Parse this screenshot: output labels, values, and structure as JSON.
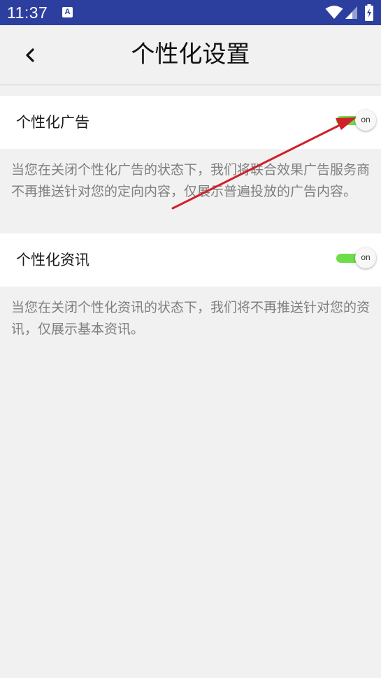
{
  "status_bar": {
    "time": "11:37",
    "notification_icon": "a-icon",
    "notification_glyph": "A",
    "icons": [
      "wifi-icon",
      "signal-icon",
      "battery-icon"
    ]
  },
  "header": {
    "back_icon": "chevron-left-icon",
    "title": "个性化设置"
  },
  "settings": [
    {
      "label": "个性化广告",
      "toggle_text": "on",
      "enabled": true,
      "description": "当您在关闭个性化广告的状态下，我们将联合效果广告服务商不再推送针对您的定向内容，仅展示普遍投放的广告内容。"
    },
    {
      "label": "个性化资讯",
      "toggle_text": "on",
      "enabled": true,
      "description": "当您在关闭个性化资讯的状态下，我们将不再推送针对您的资讯，仅展示基本资讯。"
    }
  ],
  "colors": {
    "status_bar": "#2d3f9e",
    "toggle_on": "#6fdc4a",
    "annotation_arrow": "#d0202a"
  }
}
